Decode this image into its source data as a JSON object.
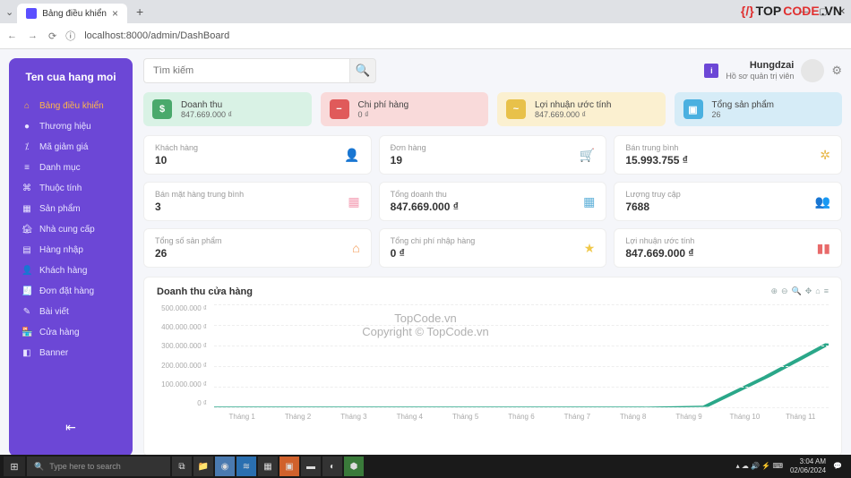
{
  "browser": {
    "tab_title": "Bảng điều khiển",
    "url": "localhost:8000/admin/DashBoard"
  },
  "watermark": {
    "logo_a": "TOP",
    "logo_b": "CODE",
    "logo_c": ".VN",
    "center1": "TopCode.vn",
    "center2": "Copyright © TopCode.vn"
  },
  "sidebar": {
    "brand": "Ten cua hang moi",
    "items": [
      {
        "icon": "⌂",
        "label": "Bảng điều khiển"
      },
      {
        "icon": "●",
        "label": "Thương hiệu"
      },
      {
        "icon": "⁒",
        "label": "Mã giảm giá"
      },
      {
        "icon": "≡",
        "label": "Danh mục"
      },
      {
        "icon": "⌘",
        "label": "Thuộc tính"
      },
      {
        "icon": "▦",
        "label": "Sản phẩm"
      },
      {
        "icon": "🏚",
        "label": "Nhà cung cấp"
      },
      {
        "icon": "▤",
        "label": "Hàng nhập"
      },
      {
        "icon": "👤",
        "label": "Khách hàng"
      },
      {
        "icon": "🧾",
        "label": "Đơn đặt hàng"
      },
      {
        "icon": "✎",
        "label": "Bài viết"
      },
      {
        "icon": "🏪",
        "label": "Cửa hàng"
      },
      {
        "icon": "◧",
        "label": "Banner"
      }
    ]
  },
  "search": {
    "placeholder": "Tìm kiếm"
  },
  "user": {
    "name": "Hungdzai",
    "role": "Hồ sơ quản trị viên",
    "badge": "i"
  },
  "tiles": [
    {
      "icon": "$",
      "label": "Doanh thu",
      "value": "847.669.000 ₫"
    },
    {
      "icon": "−",
      "label": "Chi phí hàng",
      "value": "0 ₫"
    },
    {
      "icon": "~",
      "label": "Lợi nhuận ước tính",
      "value": "847.669.000 ₫"
    },
    {
      "icon": "▣",
      "label": "Tổng sản phẩm",
      "value": "26"
    }
  ],
  "stats": [
    {
      "label": "Khách hàng",
      "value": "10",
      "icon": "si-user",
      "glyph": "👤"
    },
    {
      "label": "Đơn hàng",
      "value": "19",
      "icon": "si-cart",
      "glyph": "🛒"
    },
    {
      "label": "Bán trung bình",
      "value": "15.993.755 ₫",
      "icon": "si-gear",
      "glyph": "✲"
    },
    {
      "label": "Bán mặt hàng trung bình",
      "value": "3",
      "icon": "si-calc",
      "glyph": "▦"
    },
    {
      "label": "Tổng doanh thu",
      "value": "847.669.000 ₫",
      "icon": "si-grid",
      "glyph": "▦"
    },
    {
      "label": "Lượng truy cập",
      "value": "7688",
      "icon": "si-people",
      "glyph": "👥"
    },
    {
      "label": "Tổng số sản phẩm",
      "value": "26",
      "icon": "si-house",
      "glyph": "⌂"
    },
    {
      "label": "Tổng chi phí nhập hàng",
      "value": "0 ₫",
      "icon": "si-star",
      "glyph": "★"
    },
    {
      "label": "Lợi nhuận ước tính",
      "value": "847.669.000 ₫",
      "icon": "si-bar",
      "glyph": "▮▮"
    }
  ],
  "chart_data": {
    "type": "line",
    "title": "Doanh thu cửa hàng",
    "ylabel": "₫",
    "ylim": [
      0,
      500000000
    ],
    "yticks": [
      "500.000.000 ₫",
      "400.000.000 ₫",
      "300.000.000 ₫",
      "200.000.000 ₫",
      "100.000.000 ₫",
      "0 ₫"
    ],
    "categories": [
      "Tháng 1",
      "Tháng 2",
      "Tháng 3",
      "Tháng 4",
      "Tháng 5",
      "Tháng 6",
      "Tháng 7",
      "Tháng 8",
      "Tháng 9",
      "Tháng 10",
      "Tháng 11"
    ],
    "values": [
      0,
      0,
      0,
      0,
      0,
      0,
      0,
      0,
      5000000,
      150000000,
      310000000
    ]
  },
  "taskbar": {
    "search_placeholder": "Type here to search",
    "time": "3:04 AM",
    "date": "02/06/2024"
  }
}
